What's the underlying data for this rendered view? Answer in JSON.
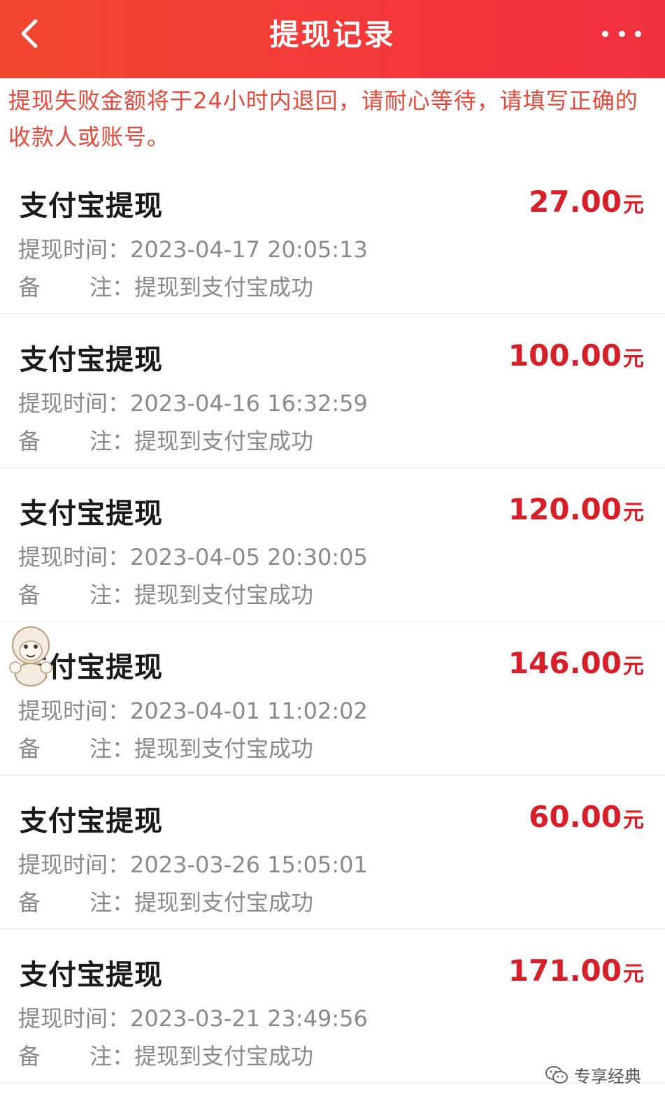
{
  "header": {
    "title": "提现记录"
  },
  "notice": "提现失败金额将于24小时内退回，请耐心等待，请填写正确的收款人或账号。",
  "labels": {
    "time_label": "提现时间：",
    "note_label_1": "备",
    "note_label_2": "注：",
    "currency_unit": "元"
  },
  "records": [
    {
      "title": "支付宝提现",
      "amount": "27.00",
      "time": "2023-04-17 20:05:13",
      "note": "提现到支付宝成功"
    },
    {
      "title": "支付宝提现",
      "amount": "100.00",
      "time": "2023-04-16 16:32:59",
      "note": "提现到支付宝成功"
    },
    {
      "title": "支付宝提现",
      "amount": "120.00",
      "time": "2023-04-05 20:30:05",
      "note": "提现到支付宝成功"
    },
    {
      "title": "支付宝提现",
      "amount": "146.00",
      "time": "2023-04-01 11:02:02",
      "note": "提现到支付宝成功"
    },
    {
      "title": "支付宝提现",
      "amount": "60.00",
      "time": "2023-03-26 15:05:01",
      "note": "提现到支付宝成功"
    },
    {
      "title": "支付宝提现",
      "amount": "171.00",
      "time": "2023-03-21 23:49:56",
      "note": "提现到支付宝成功"
    }
  ],
  "watermark": {
    "text": "专享经典",
    "icon": "wechat-icon"
  },
  "colors": {
    "header_bg": "#f2472f",
    "notice_text": "#e64a3c",
    "amount_text": "#d71f2a"
  }
}
